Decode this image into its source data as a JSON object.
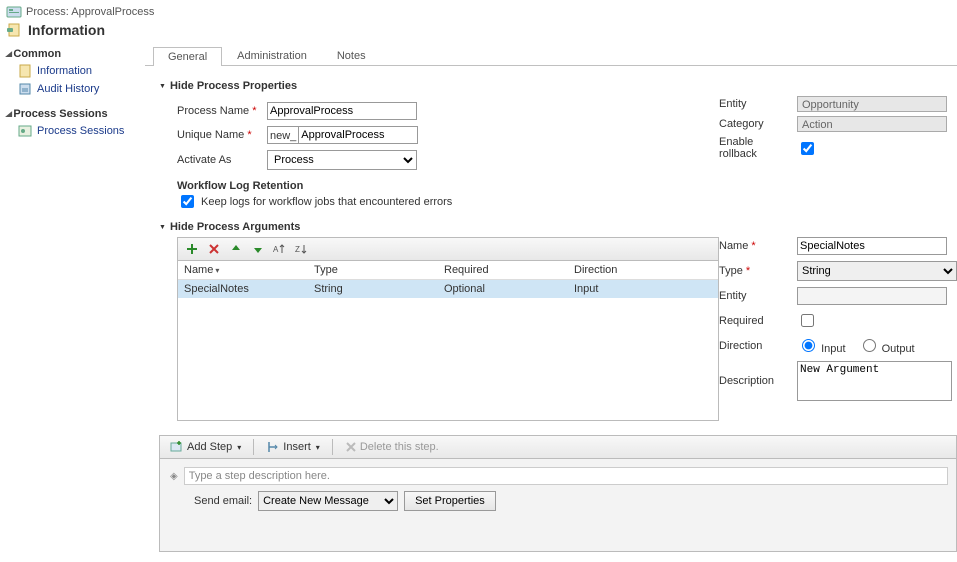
{
  "header": {
    "breadcrumb": "Process: ApprovalProcess",
    "title": "Information"
  },
  "sidebar": {
    "common_label": "Common",
    "items_common": [
      {
        "label": "Information"
      },
      {
        "label": "Audit History"
      }
    ],
    "sessions_label": "Process Sessions",
    "items_sessions": [
      {
        "label": "Process Sessions"
      }
    ]
  },
  "tabs": {
    "general": "General",
    "admin": "Administration",
    "notes": "Notes"
  },
  "props": {
    "hide_label": "Hide Process Properties",
    "process_name_lbl": "Process Name",
    "process_name_val": "ApprovalProcess",
    "unique_name_lbl": "Unique Name",
    "unique_prefix": "new_",
    "unique_name_val": "ApprovalProcess",
    "activate_as_lbl": "Activate As",
    "activate_as_val": "Process",
    "entity_lbl": "Entity",
    "entity_val": "Opportunity",
    "category_lbl": "Category",
    "category_val": "Action",
    "rollback_lbl": "Enable rollback",
    "log_head": "Workflow Log Retention",
    "log_chk": "Keep logs for workflow jobs that encountered errors"
  },
  "args": {
    "hide_label": "Hide Process Arguments",
    "headers": {
      "name": "Name",
      "type": "Type",
      "required": "Required",
      "direction": "Direction"
    },
    "rows": [
      {
        "name": "SpecialNotes",
        "type": "String",
        "required": "Optional",
        "direction": "Input"
      }
    ],
    "form": {
      "name_lbl": "Name",
      "name_val": "SpecialNotes",
      "type_lbl": "Type",
      "type_val": "String",
      "entity_lbl": "Entity",
      "required_lbl": "Required",
      "direction_lbl": "Direction",
      "input_lbl": "Input",
      "output_lbl": "Output",
      "desc_lbl": "Description",
      "desc_val": "New Argument"
    }
  },
  "steps": {
    "add_step": "Add Step",
    "insert": "Insert",
    "delete": "Delete this step.",
    "placeholder": "Type a step description here.",
    "send_email_lbl": "Send email:",
    "send_email_opt": "Create New Message",
    "set_props": "Set Properties"
  }
}
